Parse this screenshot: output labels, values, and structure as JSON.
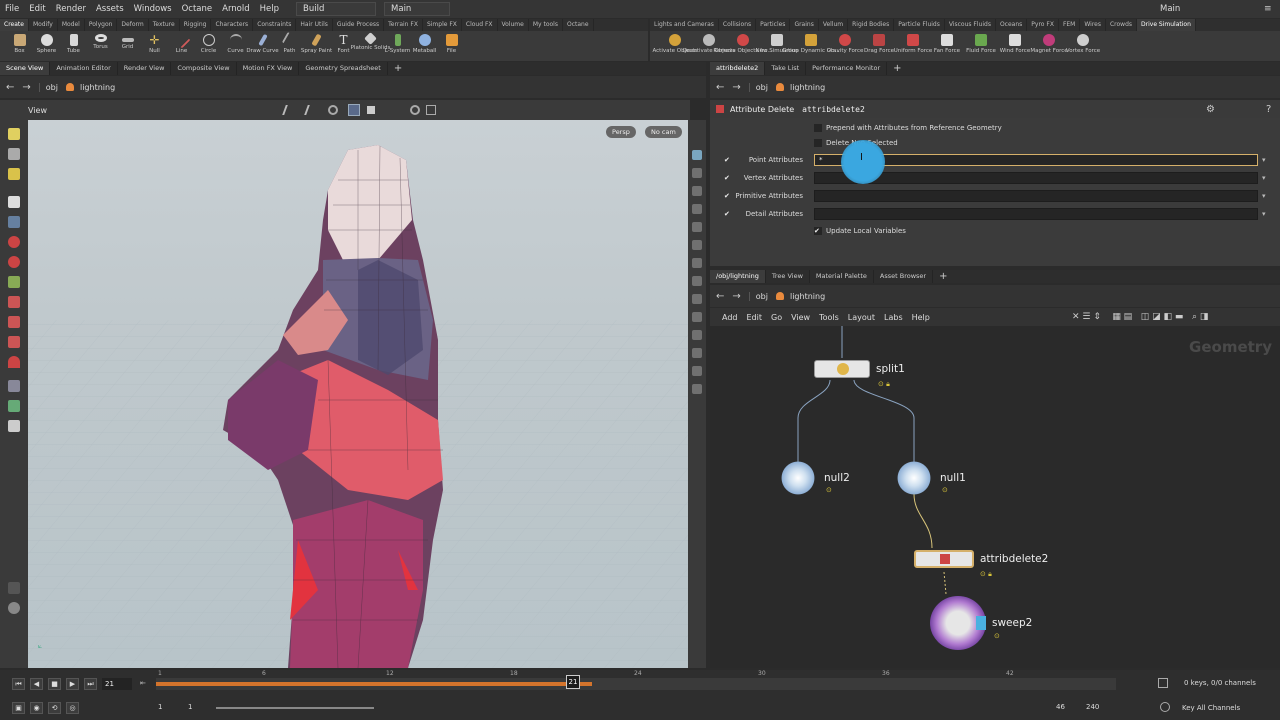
{
  "menubar": {
    "items": [
      "File",
      "Edit",
      "Render",
      "Assets",
      "Windows",
      "Octane",
      "Arnold",
      "Help"
    ],
    "desktop": "Build",
    "view_mode": "Main",
    "right_title": "Main"
  },
  "shelf_left": {
    "tabs": [
      "Create",
      "Modify",
      "Model",
      "Polygon",
      "Deform",
      "Texture",
      "Rigging",
      "Characters",
      "Constraints",
      "Hair Utils",
      "Guide Process",
      "Terrain FX",
      "Simple FX",
      "Cloud FX",
      "Volume",
      "My tools",
      "Octane"
    ],
    "tools": [
      "Box",
      "Sphere",
      "Tube",
      "Torus",
      "Grid",
      "Null",
      "Line",
      "Circle",
      "Curve",
      "Draw Curve",
      "Path",
      "Spray Paint",
      "Font",
      "Platonic Solids",
      "L-System",
      "Metaball",
      "File"
    ]
  },
  "shelf_right": {
    "tabs": [
      "Lights and Cameras",
      "Collisions",
      "Particles",
      "Grains",
      "Vellum",
      "Rigid Bodies",
      "Particle Fluids",
      "Viscous Fluids",
      "Oceans",
      "Pyro FX",
      "FEM",
      "Wires",
      "Crowds",
      "Drive Simulation"
    ],
    "tools": [
      "Activate Objects",
      "Deactivate Objects",
      "Remove Objects fro...",
      "New Simulation",
      "Group Dynamic Ob...",
      "Gravity Force",
      "Drag Force",
      "Uniform Force",
      "Fan Force",
      "Fluid Force",
      "Wind Force",
      "Magnet Force",
      "Vortex Force"
    ]
  },
  "left_pane": {
    "tabs": [
      "Scene View",
      "Animation Editor",
      "Render View",
      "Composite View",
      "Motion FX View",
      "Geometry Spreadsheet"
    ],
    "path_root": "obj",
    "path_node": "lightning",
    "viewport_label": "View",
    "persp": "Persp",
    "cam": "No cam"
  },
  "timeline": {
    "current_frame": "21",
    "start": "1",
    "start2": "1",
    "end_visible": "46",
    "end": "240",
    "ticks": [
      "1",
      "6",
      "12",
      "18",
      "24",
      "30",
      "36",
      "42"
    ],
    "keys_info": "0 keys, 0/0 channels",
    "key_all": "Key All Channels"
  },
  "params_pane": {
    "tabs": [
      "attribdelete2",
      "Take List",
      "Performance Monitor"
    ],
    "path_root": "obj",
    "path_node": "lightning",
    "node_type": "Attribute Delete",
    "node_name": "attribdelete2",
    "prepend_label": "Prepend with Attributes from Reference Geometry",
    "delete_non_selected_label": "Delete Non Selected",
    "rows": [
      {
        "label": "Point Attributes",
        "value": "*"
      },
      {
        "label": "Vertex Attributes",
        "value": ""
      },
      {
        "label": "Primitive Attributes",
        "value": ""
      },
      {
        "label": "Detail Attributes",
        "value": ""
      }
    ],
    "update_local_label": "Update Local Variables",
    "check_glyph": "✔"
  },
  "network_pane": {
    "tabs": [
      "/obj/lightning",
      "Tree View",
      "Material Palette",
      "Asset Browser"
    ],
    "path_root": "obj",
    "path_node": "lightning",
    "menu": [
      "Add",
      "Edit",
      "Go",
      "View",
      "Tools",
      "Layout",
      "Labs",
      "Help"
    ],
    "context": "Geometry",
    "nodes": {
      "split": "split1",
      "null2": "null2",
      "null1": "null1",
      "attribdelete": "attribdelete2",
      "sweep": "sweep2"
    }
  },
  "colors": {
    "accent_selected": "#d5b06a",
    "cursor_highlight": "#3aa7e0",
    "timeline_range": "#d4742c"
  }
}
